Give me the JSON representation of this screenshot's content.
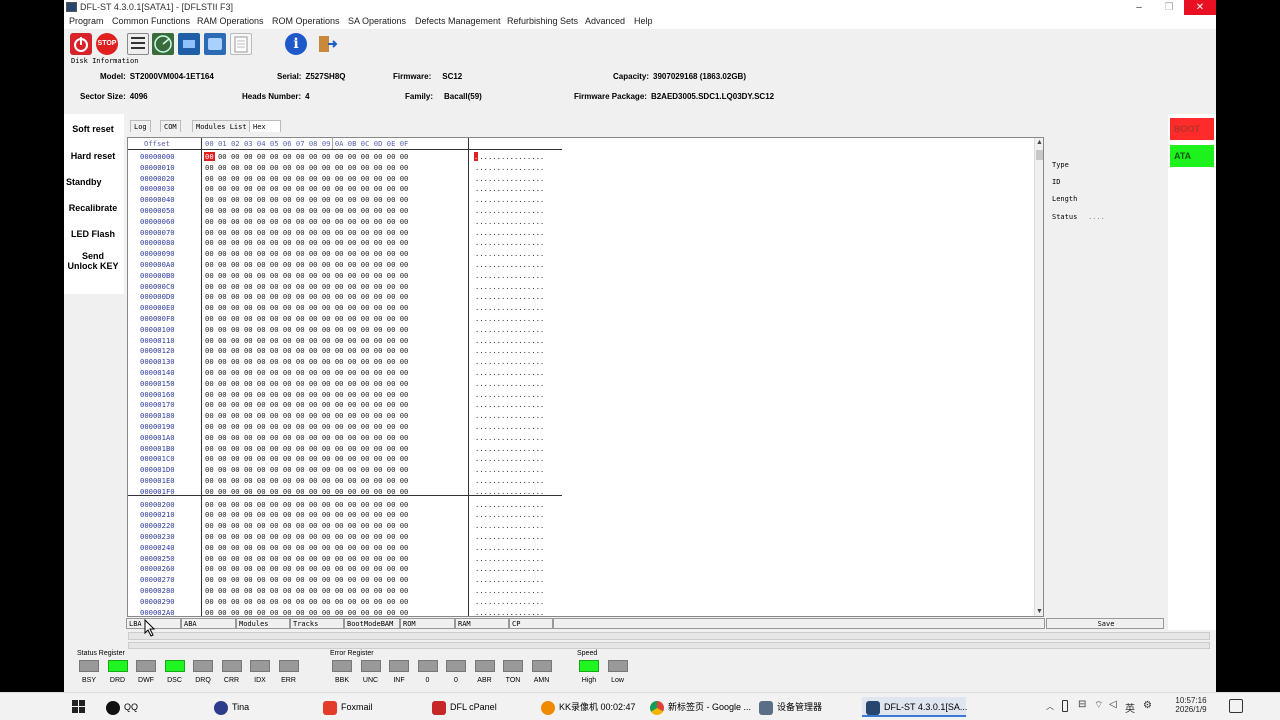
{
  "window": {
    "title": "DFL-ST 4.3.0.1[SATA1] - [DFLSTII  F3]",
    "controls": [
      "–",
      "❐",
      "✕"
    ]
  },
  "menu": [
    "Program",
    "Common Functions",
    "RAM Operations",
    "ROM Operations",
    "SA Operations",
    "Defects Management",
    "Refurbishing Sets",
    "Advanced",
    "Help"
  ],
  "toolbar": {
    "stop_label": "STOP",
    "info_label": "i"
  },
  "disk_info": {
    "legend": "Disk Information",
    "model_label": "Model:",
    "model": "ST2000VM004-1ET164",
    "serial_label": "Serial:",
    "serial": "Z527SH8Q",
    "firmware_label": "Firmware:",
    "firmware": "SC12",
    "capacity_label": "Capacity:",
    "capacity": "3907029168 (1863.02GB)",
    "sector_label": "Sector Size:",
    "sector": "4096",
    "heads_label": "Heads Number:",
    "heads": "4",
    "family_label": "Family:",
    "family": "Bacall(59)",
    "package_label": "Firmware Package:",
    "package": "B2AED3005.SDC1.LQ03DY.SC12"
  },
  "sidebar": [
    "Soft reset",
    "Hard reset",
    "Standby",
    "Recalibrate",
    "LED Flash"
  ],
  "sidebar_send": {
    "line1": "Send",
    "line2": "Unlock KEY"
  },
  "tabs": [
    "Log",
    "COM",
    "Modules List",
    "Hex"
  ],
  "hex": {
    "offset_header": "Offset",
    "byte_header": "00 01 02 03 04 05 06 07 08 09 0A 0B 0C 0D 0E 0F",
    "offsets": [
      "00000000",
      "00000010",
      "00000020",
      "00000030",
      "00000040",
      "00000050",
      "00000060",
      "00000070",
      "00000080",
      "00000090",
      "000000A0",
      "000000B0",
      "000000C0",
      "000000D0",
      "000000E0",
      "000000F0",
      "00000100",
      "00000110",
      "00000120",
      "00000130",
      "00000140",
      "00000150",
      "00000160",
      "00000170",
      "00000180",
      "00000190",
      "000001A0",
      "000001B0",
      "000001C0",
      "000001D0",
      "000001E0",
      "000001F0",
      "00000200",
      "00000210",
      "00000220",
      "00000230",
      "00000240",
      "00000250",
      "00000260",
      "00000270",
      "00000280",
      "00000290",
      "000002A0"
    ],
    "row_bytes": "00 00 00 00 00 00 00 00 00 00 00 00 00 00 00 00",
    "row_ascii": "................",
    "first_byte": "00",
    "first_ascii": "."
  },
  "right_info": {
    "type_label": "Type",
    "id_label": "ID",
    "length_label": "Length",
    "status_label": "Status",
    "status_value": "....",
    "save_label": "Save"
  },
  "mode_buttons": {
    "boot": "BOOT",
    "ata": "ATA",
    "boot_color": "#ff2a2a",
    "ata_color": "#1df21d"
  },
  "bottom_tabs": [
    "LBA",
    "ABA",
    "Modules",
    "Tracks",
    "BootModeBAM",
    "ROM",
    "RAM",
    "CP"
  ],
  "status_register": {
    "title": "Status Register",
    "bits": [
      {
        "name": "BSY",
        "on": false
      },
      {
        "name": "DRD",
        "on": true
      },
      {
        "name": "DWF",
        "on": false
      },
      {
        "name": "DSC",
        "on": true
      },
      {
        "name": "DRQ",
        "on": false
      },
      {
        "name": "CRR",
        "on": false
      },
      {
        "name": "IDX",
        "on": false
      },
      {
        "name": "ERR",
        "on": false
      }
    ]
  },
  "error_register": {
    "title": "Error Register",
    "bits": [
      {
        "name": "BBK",
        "on": false
      },
      {
        "name": "UNC",
        "on": false
      },
      {
        "name": "INF",
        "on": false
      },
      {
        "name": "0",
        "on": false
      },
      {
        "name": "0",
        "on": false
      },
      {
        "name": "ABR",
        "on": false
      },
      {
        "name": "TON",
        "on": false
      },
      {
        "name": "AMN",
        "on": false
      }
    ]
  },
  "speed": {
    "title": "Speed",
    "bits": [
      {
        "name": "High",
        "on": true
      },
      {
        "name": "Low",
        "on": false
      }
    ]
  },
  "taskbar": {
    "items": [
      "QQ",
      "Tina",
      "Foxmail",
      "DFL cPanel",
      "KK录像机 00:02:47",
      "新标签页 - Google ...",
      "设备管理器",
      "DFL-ST 4.3.0.1[SA..."
    ],
    "ime": "英",
    "time": "10:57:16",
    "date": "2026/1/9"
  }
}
